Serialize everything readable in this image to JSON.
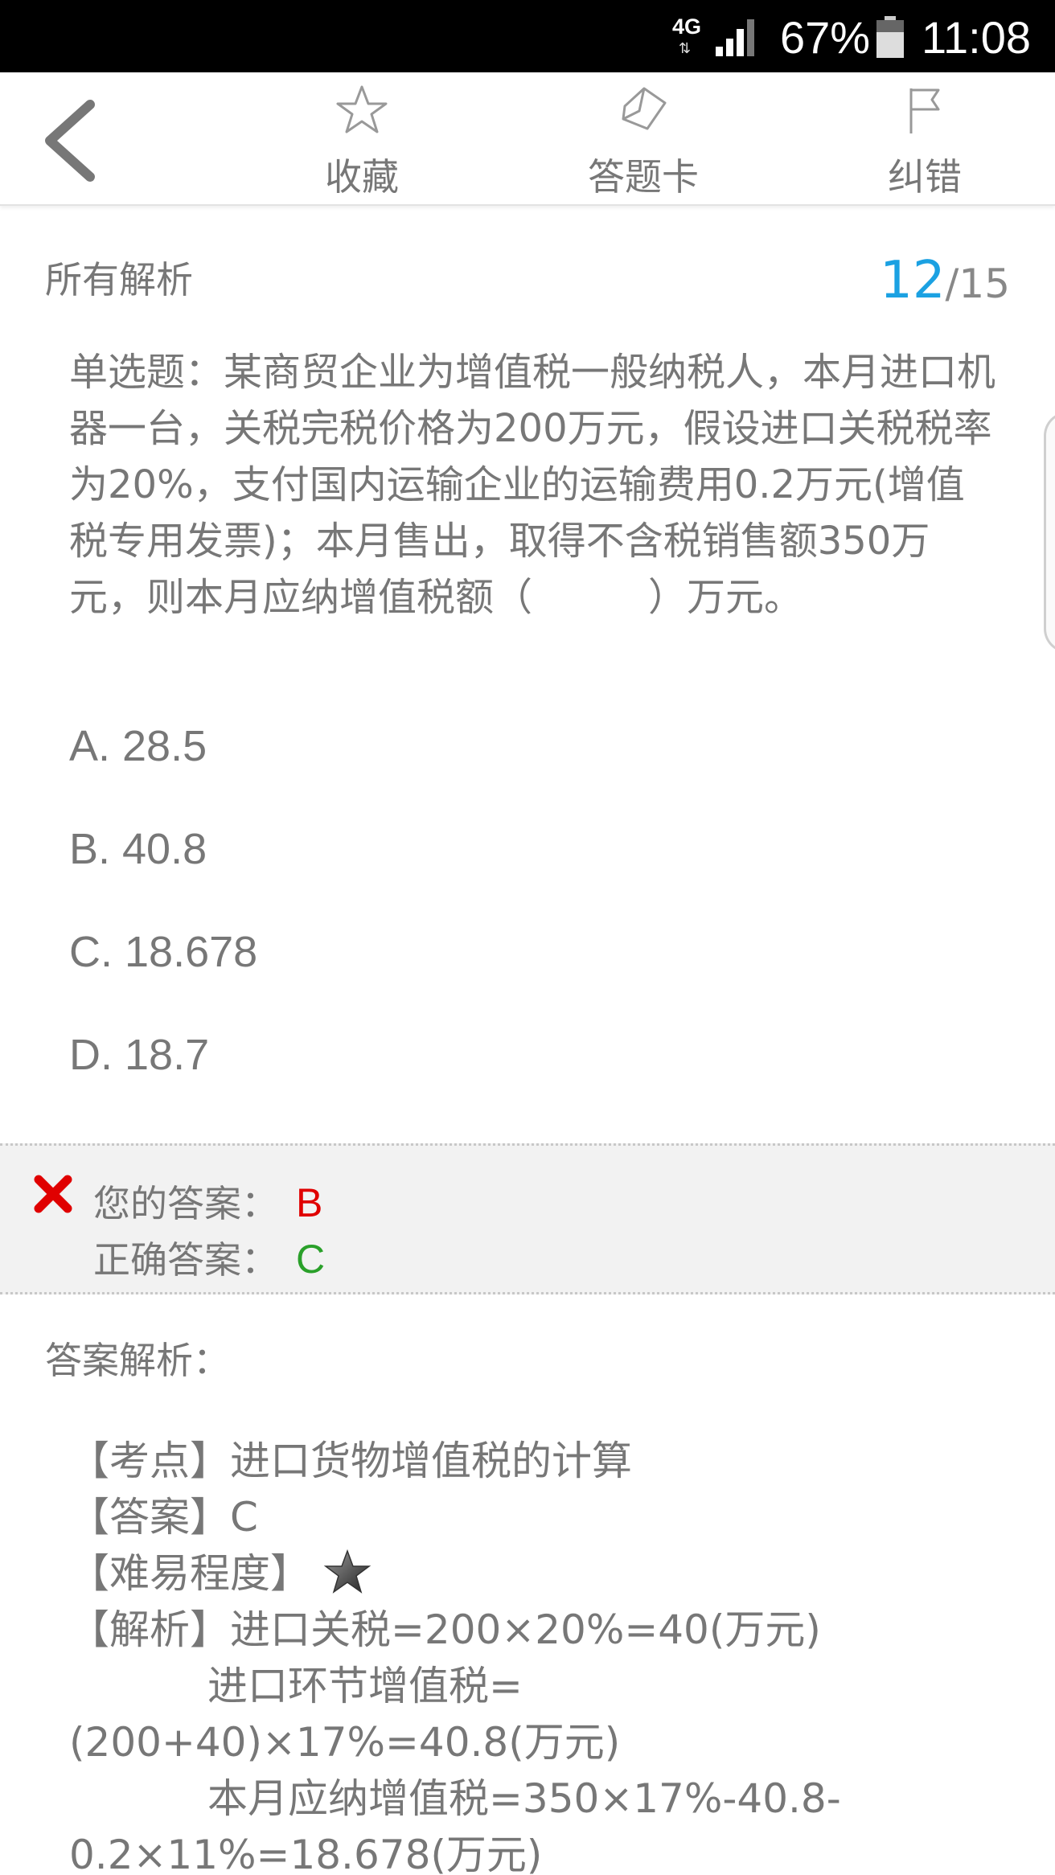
{
  "status_bar": {
    "network": "4G",
    "battery": "67%",
    "time": "11:08"
  },
  "toolbar": {
    "favorite_label": "收藏",
    "answer_card_label": "答题卡",
    "report_label": "纠错"
  },
  "header": {
    "section_title": "所有解析",
    "current": "12",
    "total": "/15"
  },
  "question": {
    "text": "单选题：某商贸企业为增值税一般纳税人，本月进口机器一台，关税完税价格为200万元，假设进口关税税率为20%，支付国内运输企业的运输费用0.2万元(增值税专用发票)；本月售出，取得不含税销售额350万元，则本月应纳增值税额（　　　）万元。",
    "options": [
      "A. 28.5",
      "B. 40.8",
      "C. 18.678",
      "D. 18.7"
    ]
  },
  "answer": {
    "your_label": "您的答案：",
    "your_value": "B",
    "correct_label": "正确答案：",
    "correct_value": "C",
    "colors": {
      "wrong": "#e00000",
      "correct": "#2aa02a"
    }
  },
  "analysis": {
    "title": "答案解析：",
    "lines": [
      "【考点】进口货物增值税的计算",
      "【答案】C",
      "【难易程度】",
      "【解析】进口关税=200×20%=40(万元)",
      "进口环节增值税=",
      "(200+40)×17%=40.8(万元)",
      "本月应纳增值税=350×17%-40.8-",
      "0.2×11%=18.678(万元)"
    ]
  },
  "colors": {
    "accent": "#1ba1e2",
    "status_bar": "#000000"
  }
}
